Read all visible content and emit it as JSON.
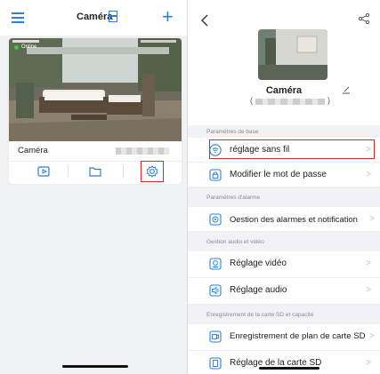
{
  "left": {
    "title": "Caméra",
    "camera_card": {
      "status": "Online",
      "name": "Caméra"
    },
    "icons": [
      "menu-icon",
      "grid-icon",
      "plus-icon",
      "playback-icon",
      "folder-icon",
      "settings-icon"
    ]
  },
  "right": {
    "device_title": "Caméra",
    "serial_open": "(",
    "serial_close": ")",
    "sections": {
      "basic": "Paramètres de base",
      "alarm": "Paramètres d'alarme",
      "audio_video": "Gestion audio et vidéo",
      "sd": "Enregistrement de la carte SD et capacité"
    },
    "rows": {
      "wifi": "réglage sans fil",
      "password": "Modifier le mot de passe",
      "alarms": "Oestion des alarmes et notification",
      "video": "Réglage vidéo",
      "audio": "Réglage audio",
      "sd_plan": "Enregistrement de plan de carte SD",
      "sd_settings": "Réglage de la carte SD"
    },
    "chevron": ">"
  },
  "colors": {
    "accent": "#2b7fd4",
    "highlight": "#d52b2b",
    "online": "#3fc54a",
    "section_bg": "#f1f2f4"
  }
}
